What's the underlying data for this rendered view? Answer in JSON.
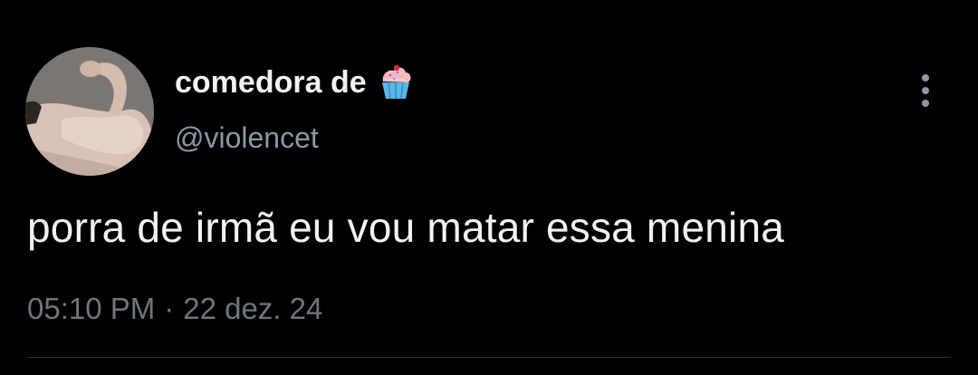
{
  "author": {
    "display_name": "comedora de",
    "display_name_emoji": "cupcake-icon",
    "handle": "@violencet",
    "avatar": "flexed-arm-photo"
  },
  "tweet": {
    "text": "porra de irmã eu vou matar essa menina",
    "time": "05:10 PM",
    "separator": "·",
    "date": "22 dez. 24"
  },
  "actions": {
    "more_icon": "more-vertical-icon"
  },
  "colors": {
    "background": "#000000",
    "primary_text": "#f2f2f2",
    "secondary_text": "#8b98a5",
    "meta_text": "#6e767d",
    "divider": "#2f3336"
  }
}
